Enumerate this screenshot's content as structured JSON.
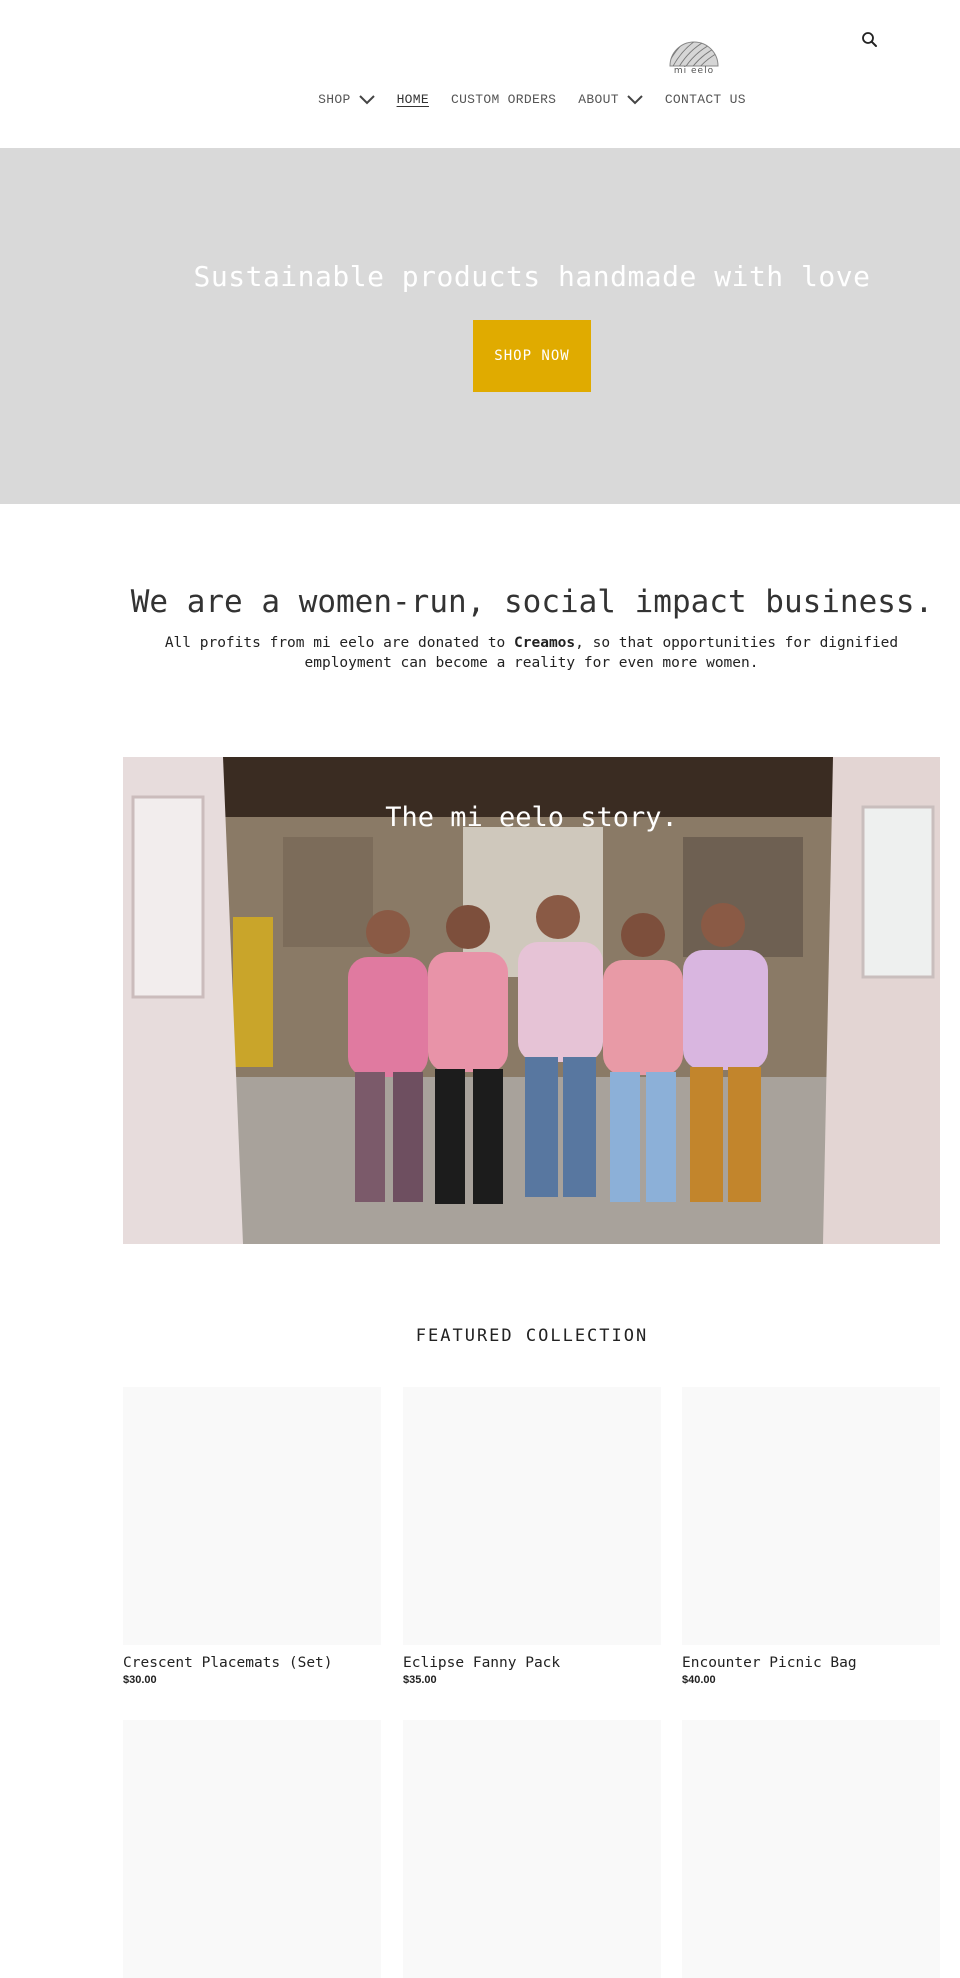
{
  "brand": {
    "name": "mi eelo"
  },
  "nav": {
    "items": [
      {
        "label": "SHOP",
        "has_dropdown": true,
        "active": false
      },
      {
        "label": "HOME",
        "has_dropdown": false,
        "active": true
      },
      {
        "label": "CUSTOM ORDERS",
        "has_dropdown": false,
        "active": false
      },
      {
        "label": "ABOUT",
        "has_dropdown": true,
        "active": false
      },
      {
        "label": "CONTACT US",
        "has_dropdown": false,
        "active": false
      }
    ],
    "search_icon": "search-icon"
  },
  "hero": {
    "title": "Sustainable products handmade with love",
    "button_label": "SHOP NOW",
    "background_color": "#d9d9d9",
    "button_color": "#e0ab00"
  },
  "mission": {
    "title": "We are a women-run, social impact business.",
    "text_before": "All profits from mi eelo are donated to ",
    "text_bold": "Creamos",
    "text_after": ", so that opportunities for dignified employment can become a reality for even more women."
  },
  "story": {
    "title": "The mi eelo story."
  },
  "featured": {
    "title": "FEATURED COLLECTION",
    "products": [
      {
        "name": "Crescent Placemats (Set)",
        "price": "$30.00"
      },
      {
        "name": "Eclipse Fanny Pack",
        "price": "$35.00"
      },
      {
        "name": "Encounter Picnic Bag",
        "price": "$40.00"
      },
      {
        "name": "",
        "price": ""
      },
      {
        "name": "",
        "price": ""
      },
      {
        "name": "",
        "price": ""
      }
    ]
  }
}
